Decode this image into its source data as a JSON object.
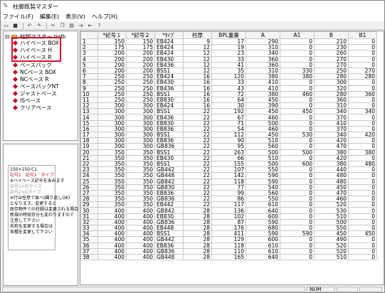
{
  "window": {
    "title": "柱脚既製マスター"
  },
  "menu": [
    "ファイル(F)",
    "編集(E)",
    "表示(V)",
    "ヘルプ(H)"
  ],
  "toolbar": [
    "new-icon",
    "save-icon",
    "undo-icon",
    "redo-icon",
    "cut-icon",
    "copy-icon",
    "paste-icon",
    "indent-icon",
    "outdent-icon",
    "help-icon"
  ],
  "tree": {
    "root": "柱脚マスター.mdb",
    "items": [
      "ハイベース BOX",
      "ハイベース H",
      "ハイベース R",
      "ベースパック",
      "NCベース BOX",
      "NCベース R",
      "ベースパックNT",
      "ジャストベース",
      "ISベース",
      "クリアベース"
    ]
  },
  "info": {
    "lines": [
      "150×150-C1",
      "記号1　記号2　タイプ",
      "",
      "※ハイベース記号を含みます",
      "記号1=柱サイズ",
      "記号2=Gタイプ",
      "",
      "※行は任意で並べ(繰り返しOK)",
      "となります。変更すると",
      "既存物件での柱脚は変更される場合",
      "新規の時既存分も変わりますので",
      "注意して下さい",
      "名称を変更する場合は",
      "各種を変更して下さい"
    ]
  },
  "table": {
    "headers": [
      "",
      "*記号１",
      "*記号２",
      "*ﾀｲﾌﾟ",
      "柱厚",
      "BPL重量",
      "A",
      "A1",
      "B",
      "B1"
    ],
    "rows": [
      [
        "1",
        "150",
        "150",
        "EB424",
        "9",
        "17",
        "290",
        "0",
        "210",
        "0"
      ],
      [
        "2",
        "175",
        "175",
        "EB424",
        "12",
        "19",
        "310",
        "0",
        "230",
        "0"
      ],
      [
        "3",
        "200",
        "200",
        "EB424",
        "12",
        "23",
        "340",
        "0",
        "260",
        "0"
      ],
      [
        "4",
        "200",
        "200",
        "EB430",
        "12",
        "33",
        "360",
        "0",
        "270",
        "0"
      ],
      [
        "5",
        "200",
        "200",
        "EB436",
        "12",
        "41",
        "360",
        "0",
        "270",
        "0"
      ],
      [
        "6",
        "200",
        "200",
        "BSS1",
        "12",
        "35",
        "310",
        "330",
        "250",
        "270"
      ],
      [
        "7",
        "250",
        "250",
        "EB424",
        "16",
        "120",
        "380",
        "380",
        "280",
        "280"
      ],
      [
        "8",
        "250",
        "250",
        "EB430",
        "16",
        "33",
        "410",
        "0",
        "300",
        "0"
      ],
      [
        "9",
        "250",
        "250",
        "EB436",
        "16",
        "43",
        "410",
        "0",
        "320",
        "0"
      ],
      [
        "10",
        "250",
        "250",
        "BSS1",
        "16",
        "72",
        "380",
        "460",
        "280",
        "360"
      ],
      [
        "11",
        "250",
        "250",
        "EB830",
        "16",
        "64",
        "450",
        "0",
        "360",
        "0"
      ],
      [
        "12",
        "300",
        "300",
        "EB424",
        "16",
        "30",
        "390",
        "0",
        "310",
        "0"
      ],
      [
        "13",
        "300",
        "300",
        "BSS1",
        "22",
        "192",
        "450",
        "450",
        "340",
        "340"
      ],
      [
        "14",
        "300",
        "300",
        "EB436",
        "22",
        "67",
        "460",
        "0",
        "370",
        "0"
      ],
      [
        "15",
        "300",
        "300",
        "EB830",
        "22",
        "71",
        "500",
        "0",
        "410",
        "0"
      ],
      [
        "16",
        "300",
        "300",
        "EB836",
        "22",
        "54",
        "460",
        "0",
        "370",
        "0"
      ],
      [
        "17",
        "300",
        "300",
        "BSS1",
        "22",
        "112",
        "450",
        "530",
        "340",
        "420"
      ],
      [
        "18",
        "300",
        "300",
        "EB836",
        "22",
        "90",
        "510",
        "0",
        "420",
        "0"
      ],
      [
        "19",
        "300",
        "300",
        "GB836",
        "22",
        "95",
        "560",
        "0",
        "470",
        "0"
      ],
      [
        "20",
        "350",
        "350",
        "BSS1",
        "22",
        "263",
        "500",
        "500",
        "380",
        "380"
      ],
      [
        "21",
        "350",
        "350",
        "EB430",
        "22",
        "66",
        "510",
        "0",
        "420",
        "0"
      ],
      [
        "22",
        "350",
        "350",
        "BSS1",
        "22",
        "155",
        "500",
        "600",
        "380",
        "480"
      ],
      [
        "23",
        "350",
        "350",
        "GB442",
        "22",
        "107",
        "550",
        "0",
        "440",
        "0"
      ],
      [
        "24",
        "350",
        "350",
        "GB448",
        "22",
        "142",
        "590",
        "0",
        "480",
        "0"
      ],
      [
        "25",
        "350",
        "350",
        "GB842",
        "22",
        "118",
        "590",
        "0",
        "480",
        "0"
      ],
      [
        "26",
        "350",
        "350",
        "GB830",
        "22",
        "77",
        "540",
        "0",
        "450",
        "0"
      ],
      [
        "27",
        "350",
        "350",
        "EB836",
        "22",
        "99",
        "560",
        "0",
        "470",
        "0"
      ],
      [
        "28",
        "350",
        "350",
        "GB836",
        "22",
        "86",
        "550",
        "0",
        "460",
        "0"
      ],
      [
        "29",
        "350",
        "350",
        "EB442",
        "22",
        "117",
        "610",
        "0",
        "520",
        "0"
      ],
      [
        "30",
        "400",
        "400",
        "GB842",
        "28",
        "136",
        "640",
        "0",
        "530",
        "0"
      ],
      [
        "31",
        "400",
        "400",
        "EB830",
        "28",
        "102",
        "600",
        "0",
        "510",
        "0"
      ],
      [
        "32",
        "400",
        "400",
        "GB836",
        "28",
        "87",
        "590",
        "0",
        "500",
        "0"
      ],
      [
        "33",
        "400",
        "400",
        "EB448",
        "28",
        "176",
        "680",
        "0",
        "550",
        "0"
      ],
      [
        "34",
        "400",
        "400",
        "BSS1",
        "28",
        "411",
        "590",
        "590",
        "450",
        "450"
      ],
      [
        "35",
        "400",
        "400",
        "GB442",
        "28",
        "129",
        "600",
        "0",
        "490",
        "0"
      ],
      [
        "36",
        "400",
        "400",
        "EB836",
        "28",
        "118",
        "610",
        "0",
        "520",
        "0"
      ],
      [
        "37",
        "400",
        "400",
        "GB836",
        "28",
        "110",
        "610",
        "0",
        "520",
        "0"
      ],
      [
        "38",
        "400",
        "400",
        "GB448",
        "28",
        "165",
        "640",
        "0",
        "510",
        "0"
      ]
    ]
  },
  "status": {
    "num": "NUM"
  }
}
